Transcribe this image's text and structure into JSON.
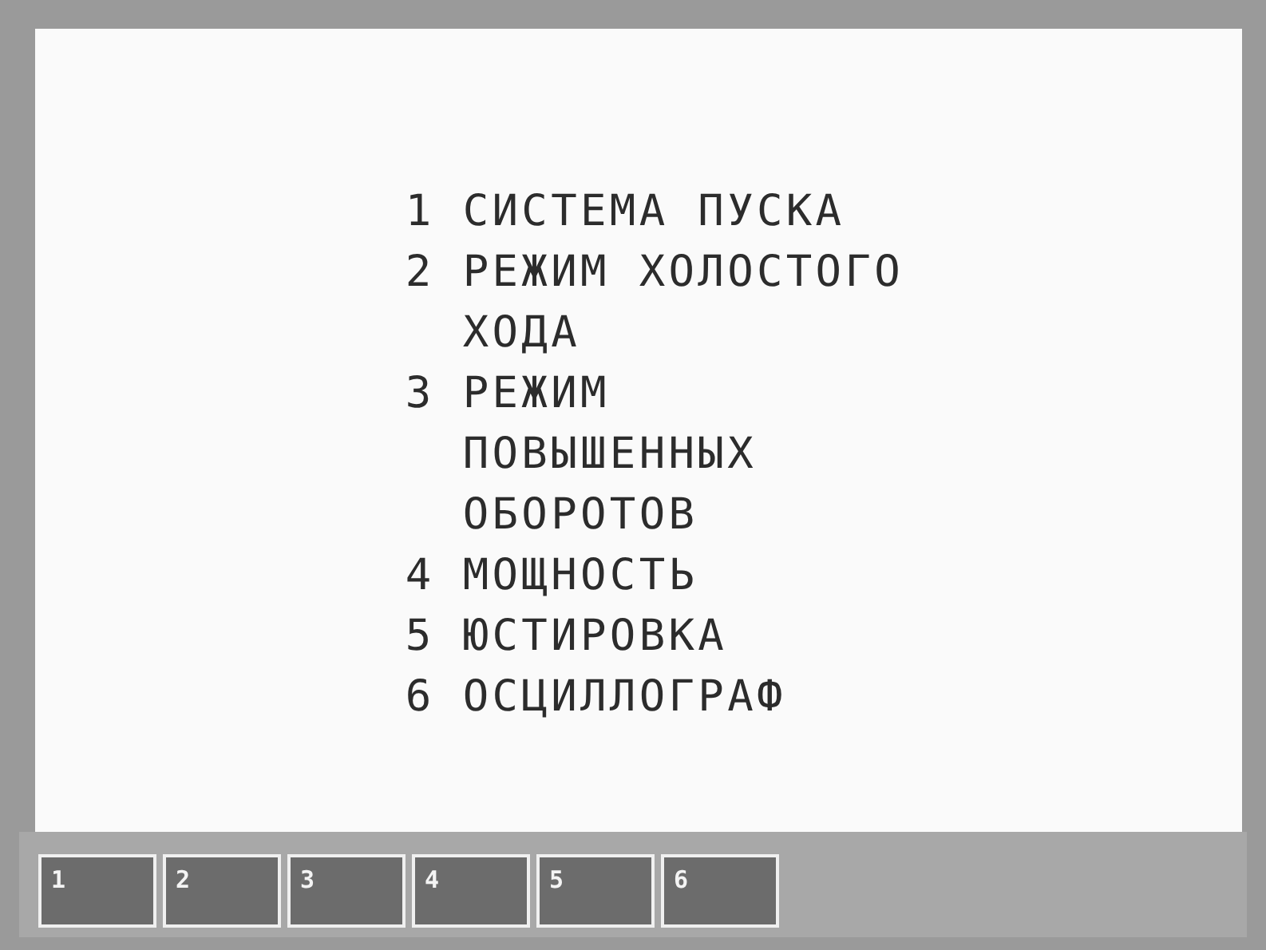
{
  "menu": [
    {
      "number": "1",
      "label": "СИСТЕМА ПУСКА"
    },
    {
      "number": "2",
      "label": "РЕЖИМ ХОЛОСТОГО ХОДА"
    },
    {
      "number": "3",
      "label": "РЕЖИМ ПОВЫШЕННЫХ ОБОРОТОВ"
    },
    {
      "number": "4",
      "label": "МОЩНОСТЬ"
    },
    {
      "number": "5",
      "label": "ЮСТИРОВКА"
    },
    {
      "number": "6",
      "label": "ОСЦИЛЛОГРАФ"
    }
  ],
  "softkeys": [
    "1",
    "2",
    "3",
    "4",
    "5",
    "6"
  ]
}
